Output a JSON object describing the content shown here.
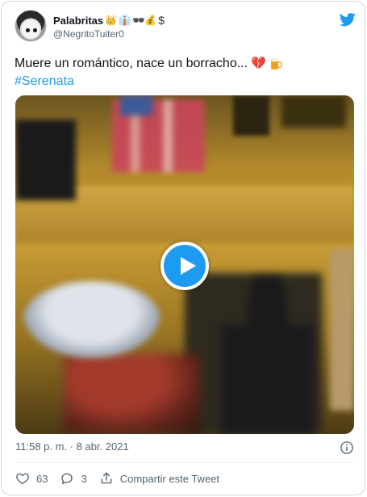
{
  "author": {
    "display_name": "Palabritas",
    "handle": "@NegritoTuiter0",
    "name_emojis": [
      "👑",
      "👔",
      "🕶",
      "💰",
      "$"
    ]
  },
  "tweet": {
    "text_line_1": "Muere un romántico, nace un borracho...",
    "text_line_1_emojis": [
      "💔",
      "🍺"
    ],
    "hashtag": "#Serenata"
  },
  "media": {
    "type": "video",
    "play_icon": "play-icon"
  },
  "meta": {
    "timestamp": "11:58 p. m. · 8 abr. 2021",
    "info_icon": "info-icon"
  },
  "actions": {
    "likes": "63",
    "replies": "3",
    "share_label": "Compartir este Tweet"
  },
  "colors": {
    "accent": "#1d9bf0",
    "text": "#0f1419",
    "secondary": "#536471",
    "border": "#cfd9de",
    "broken_heart": "#e0245e"
  }
}
